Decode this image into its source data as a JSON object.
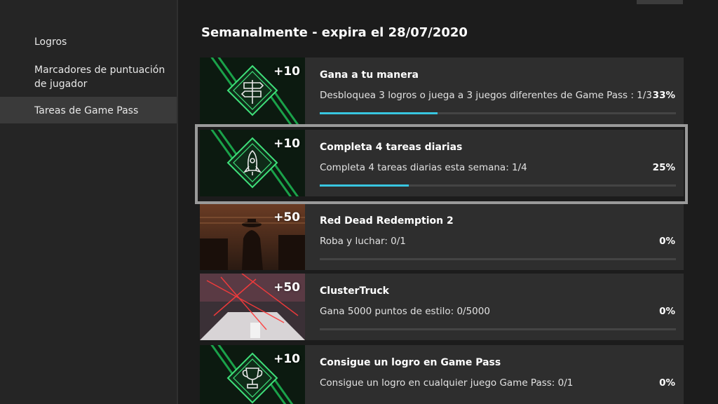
{
  "sidebar": {
    "items": [
      {
        "label": "Logros",
        "selected": false
      },
      {
        "label": "Marcadores de puntuación de jugador",
        "selected": false
      },
      {
        "label": "Tareas de Game Pass",
        "selected": true
      }
    ]
  },
  "section": {
    "title": "Semanalmente - expira el 28/07/2020"
  },
  "tasks": [
    {
      "points": "+10",
      "title": "Gana a tu manera",
      "description": "Desbloquea 3 logros o juega a 3 juegos diferentes de Game Pass : 1/3",
      "percent": "33%",
      "progress": 0.33,
      "icon": "signpost-icon",
      "focused": false
    },
    {
      "points": "+10",
      "title": "Completa 4 tareas diarias",
      "description": "Completa 4 tareas diarias esta semana: 1/4",
      "percent": "25%",
      "progress": 0.25,
      "icon": "rocket-icon",
      "focused": true
    },
    {
      "points": "+50",
      "title": "Red Dead Redemption 2",
      "description": "Roba y luchar: 0/1",
      "percent": "0%",
      "progress": 0,
      "icon": "red-dead-redemption-art",
      "focused": false
    },
    {
      "points": "+50",
      "title": "ClusterTruck",
      "description": "Gana 5000 puntos de estilo: 0/5000",
      "percent": "0%",
      "progress": 0,
      "icon": "clustertruck-art",
      "focused": false
    },
    {
      "points": "+10",
      "title": "Consigue un logro en Game Pass",
      "description": "Consigue un logro en cualquier juego Game Pass: 0/1",
      "percent": "0%",
      "progress": 0,
      "icon": "trophy-icon",
      "focused": false
    }
  ],
  "colors": {
    "progress_fill": "#38c6e0",
    "gamepass_green": "#1db954",
    "background": "#1c1c1c",
    "card": "#2e2e2e"
  }
}
